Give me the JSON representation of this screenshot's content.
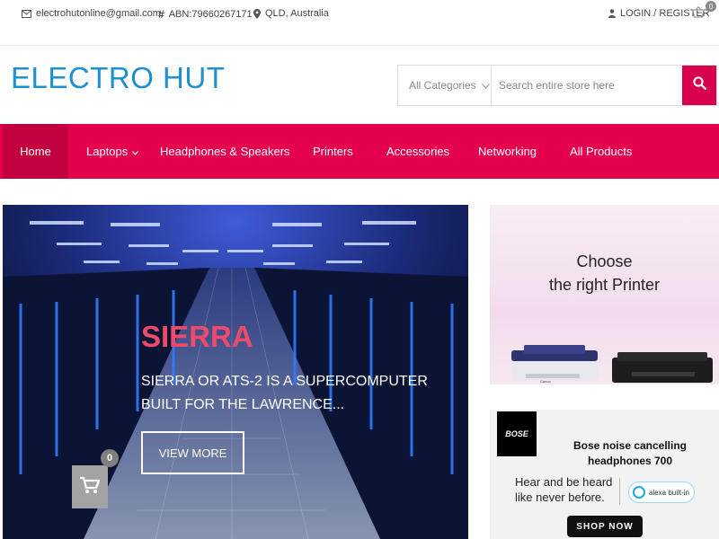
{
  "topbar": {
    "email": "electrohutonline@gmail.com",
    "abn": "ABN:79660267171",
    "location": "QLD, Australia",
    "login_register": "LOGIN / REGISTER",
    "cart_count": "0"
  },
  "header": {
    "logo_text": "ELECTRO HUT",
    "category_select": "All Categories",
    "search_placeholder": "Search entire store here"
  },
  "nav": {
    "items": [
      {
        "label": "Home",
        "active": true
      },
      {
        "label": "Laptops",
        "has_dropdown": true
      },
      {
        "label": "Headphones & Speakers"
      },
      {
        "label": "Printers"
      },
      {
        "label": "Accessories"
      },
      {
        "label": "Networking"
      },
      {
        "label": "All Products"
      }
    ]
  },
  "slider": {
    "title": "SIERRA",
    "description": "SIERRA OR ATS-2 IS A SUPERCOMPUTER BUILT FOR THE LAWRENCE...",
    "button_label": "VIEW MORE",
    "cart_count": "0"
  },
  "banner_printer": {
    "heading_line1": "Choose",
    "heading_line2": "the right Printer",
    "brand_label": "Canon"
  },
  "banner_bose": {
    "logo": "BOSE",
    "title": "Bose noise cancelling headphones 700",
    "tagline": "Hear and be heard like never before.",
    "badge": "alexa built-in",
    "button_label": "SHOP NOW"
  },
  "colors": {
    "accent": "#e5004f",
    "accent_dark": "#c3003f",
    "logo": "#1e90cf",
    "slide_title": "#ee4a6a"
  }
}
